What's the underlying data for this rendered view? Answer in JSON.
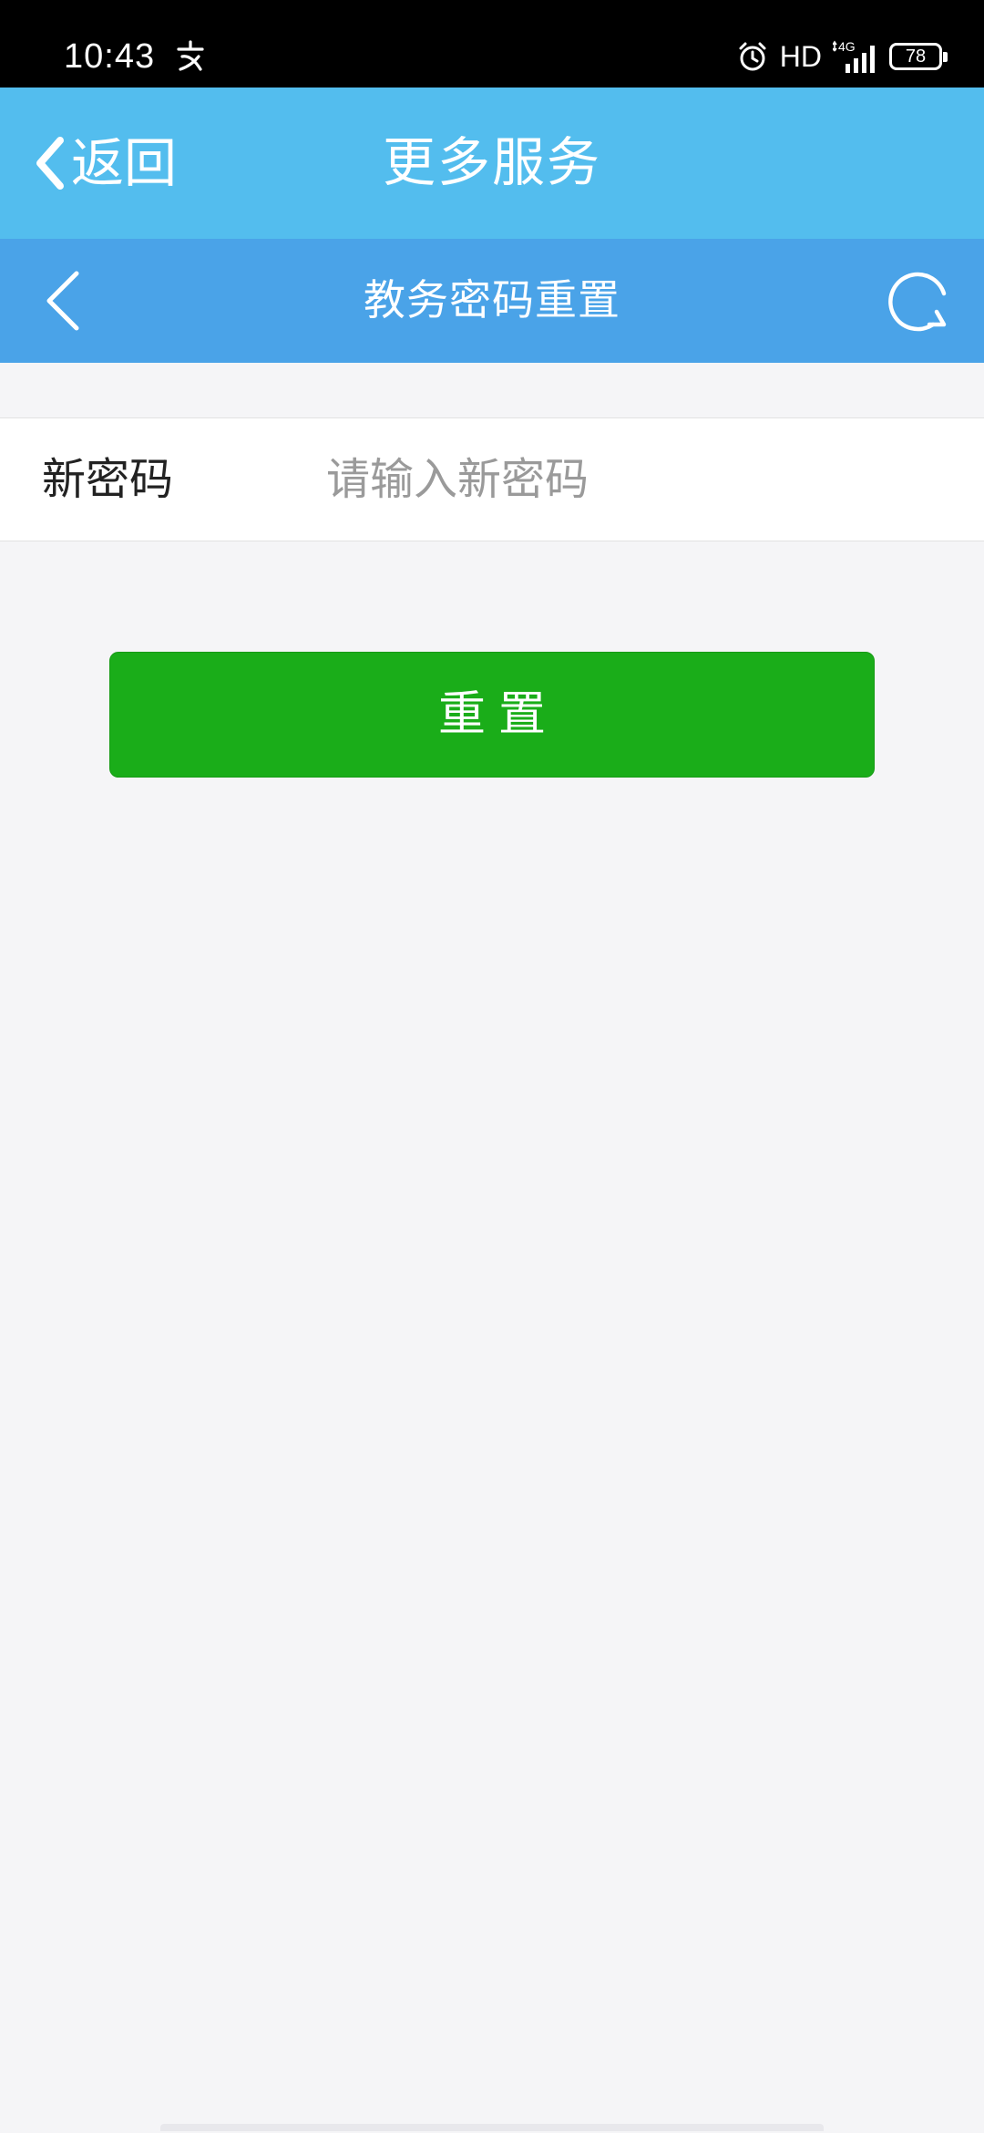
{
  "status_bar": {
    "time": "10:43",
    "network_label": "HD",
    "signal_label": "4G",
    "battery_level": "78",
    "icons": [
      "notification-icon",
      "alarm-icon",
      "signal-icon",
      "battery-icon"
    ]
  },
  "nav": {
    "back_label": "返回",
    "title": "更多服务"
  },
  "sub_header": {
    "title": "教务密码重置"
  },
  "form": {
    "new_password_label": "新密码",
    "new_password_placeholder": "请输入新密码",
    "new_password_value": ""
  },
  "actions": {
    "reset_label": "重置"
  },
  "colors": {
    "nav_bar": "#53bdee",
    "sub_header": "#4aa3e8",
    "primary_button": "#1aad19",
    "page_background": "#f5f5f7"
  }
}
